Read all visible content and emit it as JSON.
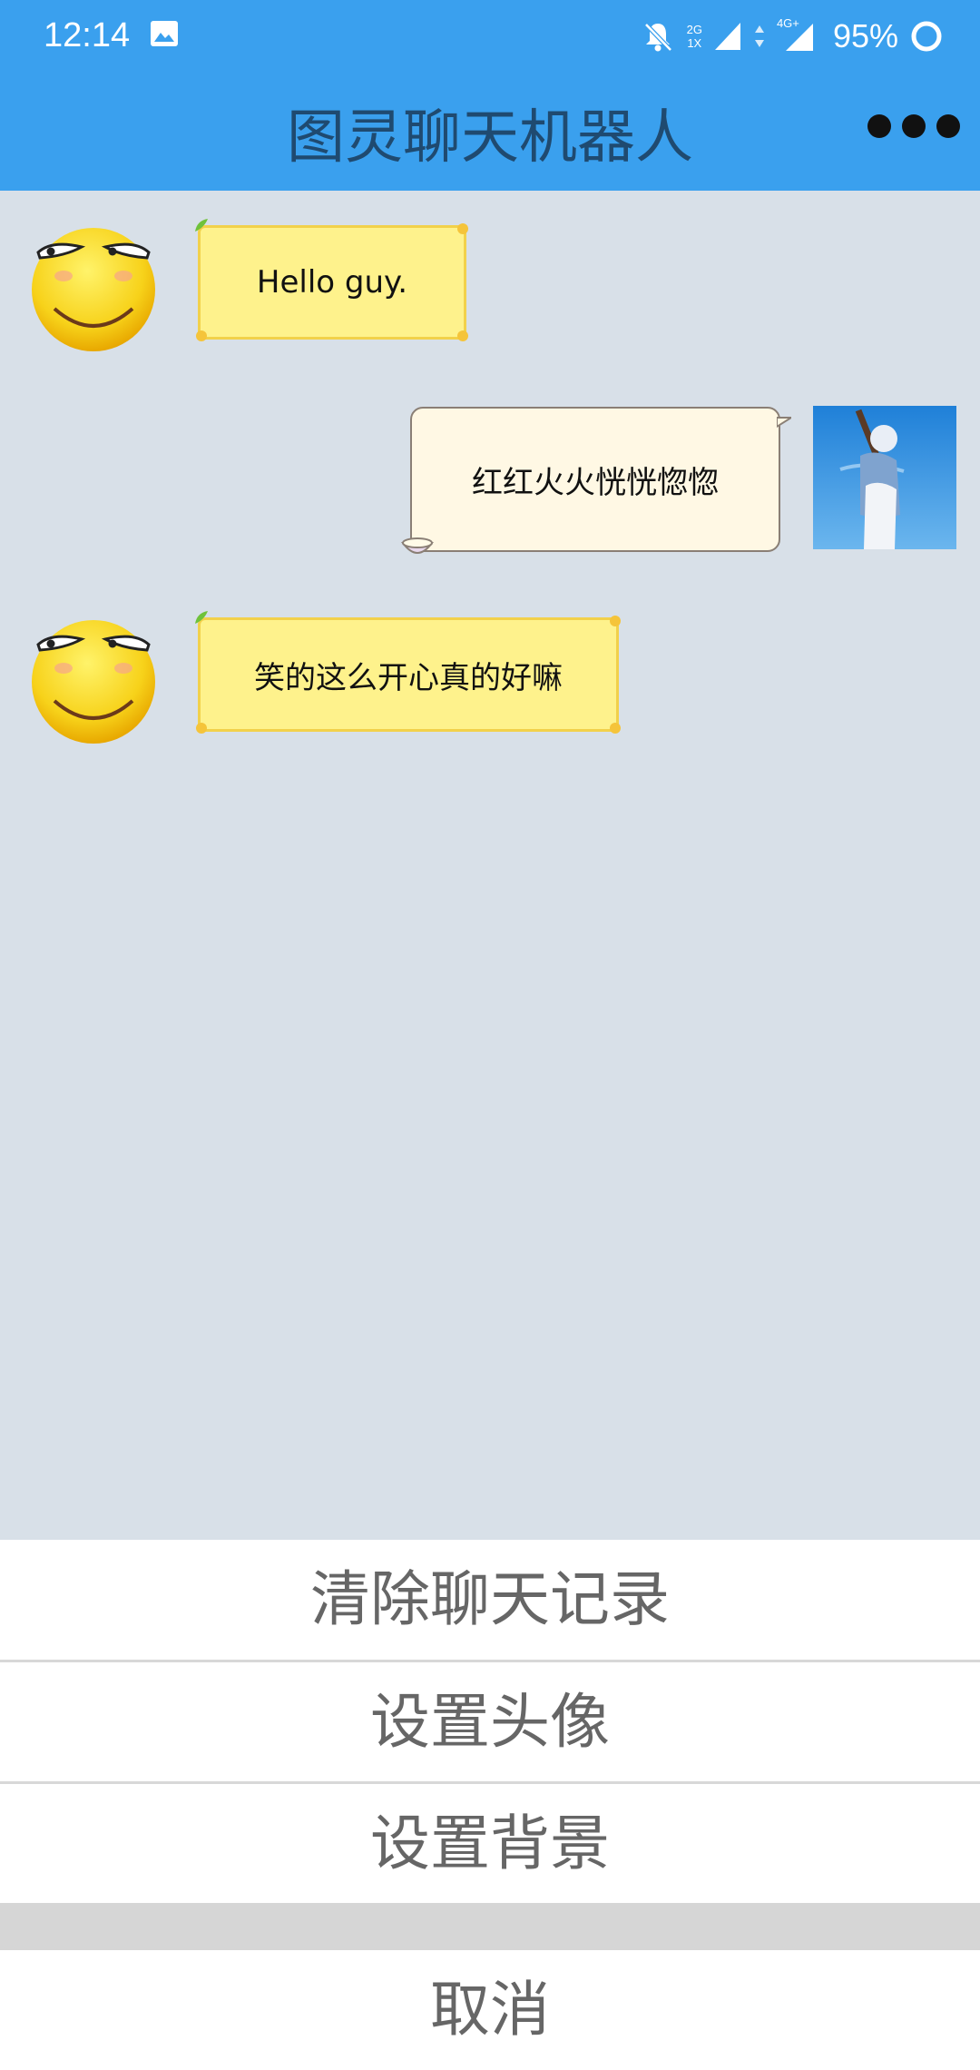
{
  "status_bar": {
    "time": "12:14",
    "network_2g": "2G",
    "network_1x": "1X",
    "network_4g": "4G+",
    "battery": "95%"
  },
  "app_bar": {
    "title": "图灵聊天机器人",
    "menu_icon": "more-dots-icon"
  },
  "colors": {
    "app_bar": "#3aa0ee",
    "chat_background": "#d8e0e8",
    "bot_bubble": "#fef28c",
    "user_bubble": "#fff8e4"
  },
  "messages": [
    {
      "sender": "bot",
      "text": "Hello guy."
    },
    {
      "sender": "user",
      "text": "红红火火恍恍惚惚"
    },
    {
      "sender": "bot",
      "text": "笑的这么开心真的好嘛"
    }
  ],
  "menu": {
    "clear_history": "清除聊天记录",
    "set_avatar": "设置头像",
    "set_background": "设置背景",
    "cancel": "取消"
  }
}
